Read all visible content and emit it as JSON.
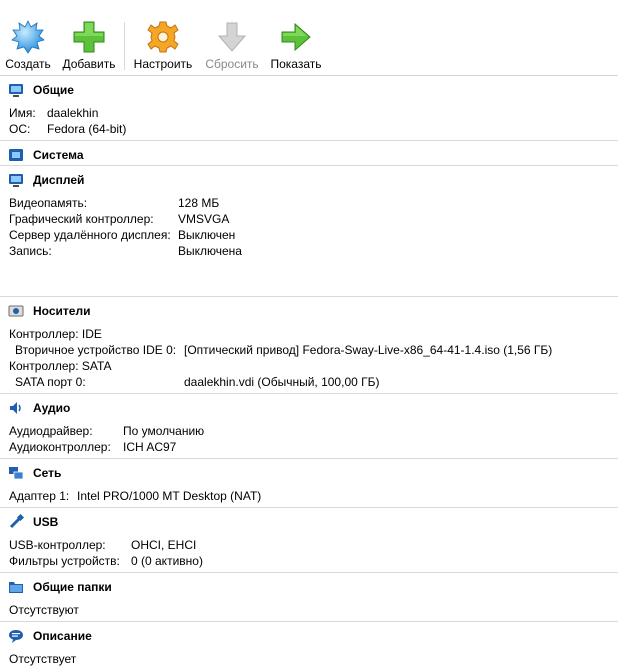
{
  "toolbar": {
    "create": "Создать",
    "add": "Добавить",
    "settings": "Настроить",
    "discard": "Сбросить",
    "show": "Показать"
  },
  "general": {
    "title": "Общие",
    "name_label": "Имя:",
    "name_value": "daalekhin",
    "os_label": "ОС:",
    "os_value": "Fedora (64-bit)"
  },
  "system": {
    "title": "Система"
  },
  "display": {
    "title": "Дисплей",
    "video_mem_label": "Видеопамять:",
    "video_mem_value": "128 МБ",
    "graphics_label": "Графический контроллер:",
    "graphics_value": "VMSVGA",
    "remote_label": "Сервер удалённого дисплея:",
    "remote_value": "Выключен",
    "recording_label": "Запись:",
    "recording_value": "Выключена"
  },
  "storage": {
    "title": "Носители",
    "ctrl_ide": "Контроллер: IDE",
    "ide_dev_label": "Вторичное устройство IDE 0:",
    "ide_dev_value": "[Оптический привод] Fedora-Sway-Live-x86_64-41-1.4.iso (1,56 ГБ)",
    "ctrl_sata": "Контроллер: SATA",
    "sata_port_label": "SATA порт 0:",
    "sata_port_value": "daalekhin.vdi (Обычный, 100,00 ГБ)"
  },
  "audio": {
    "title": "Аудио",
    "driver_label": "Аудиодрайвер:",
    "driver_value": "По умолчанию",
    "controller_label": "Аудиоконтроллер:",
    "controller_value": "ICH AC97"
  },
  "network": {
    "title": "Сеть",
    "adapter_label": "Адаптер 1:",
    "adapter_value": "Intel PRO/1000 MT Desktop (NAT)"
  },
  "usb": {
    "title": "USB",
    "controller_label": "USB-контроллер:",
    "controller_value": "OHCI, EHCI",
    "filters_label": "Фильтры устройств:",
    "filters_value": "0 (0 активно)"
  },
  "shared": {
    "title": "Общие папки",
    "value": "Отсутствуют"
  },
  "description": {
    "title": "Описание",
    "value": "Отсутствует"
  }
}
